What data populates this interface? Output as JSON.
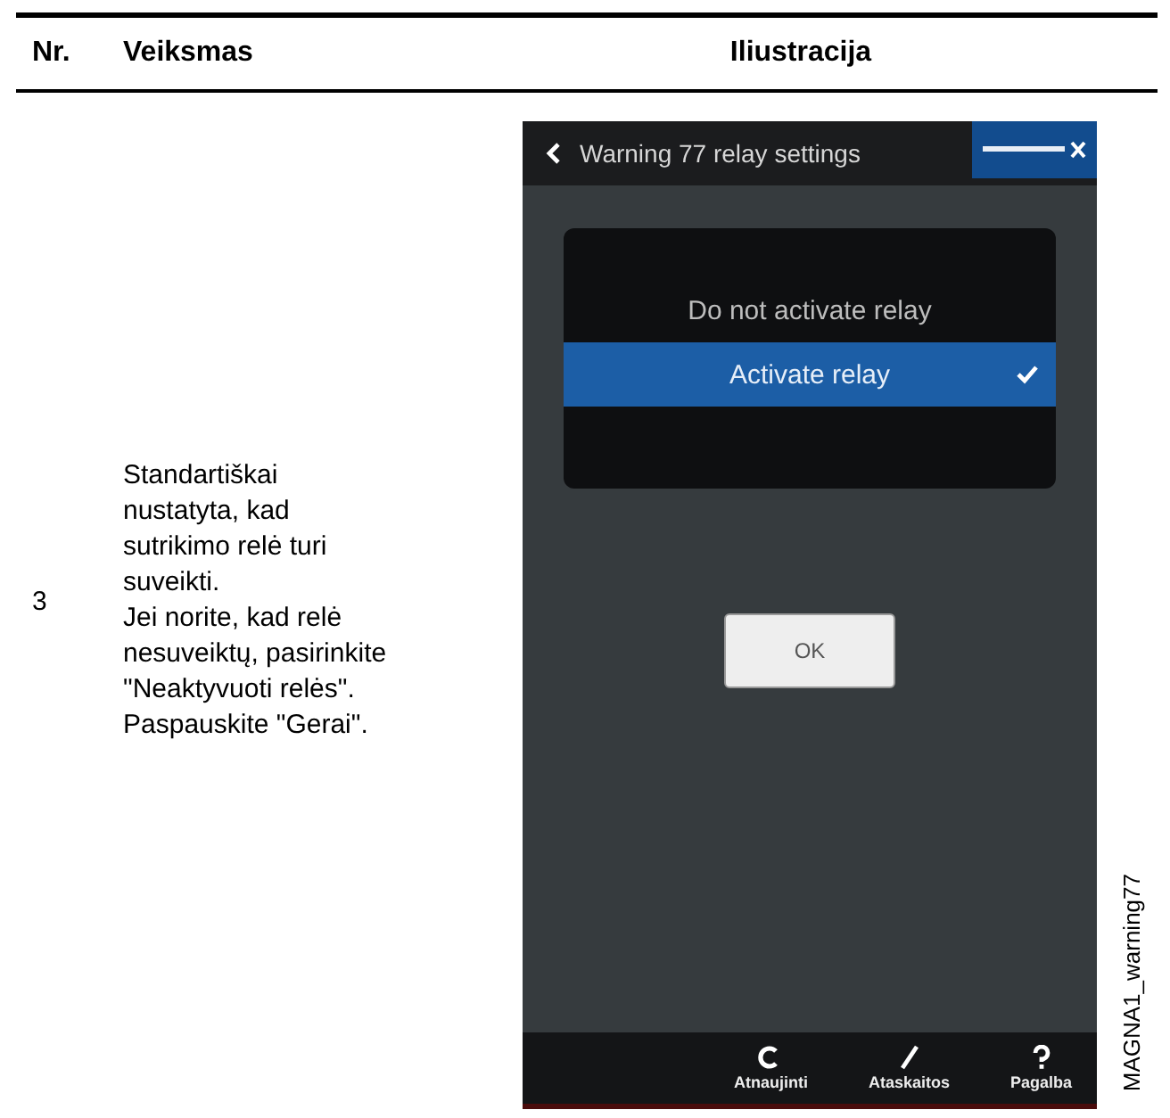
{
  "table": {
    "columns": [
      "Nr.",
      "Veiksmas",
      "Iliustracija"
    ],
    "rows": [
      {
        "number": "3",
        "action": "Standartiškai nustatyta, kad sutrikimo relė turi suveikti.\nJei norite, kad relė nesuveiktų, pasirinkite \"Neaktyvuoti relės\". Paspauskite \"Gerai\".",
        "illustration": {
          "title": "Warning 77 relay settings",
          "options": [
            {
              "label": "Do not activate relay",
              "selected": false
            },
            {
              "label": "Activate relay",
              "selected": true
            }
          ],
          "button": "OK",
          "nav": [
            {
              "kind": "refresh",
              "label": "Atnaujinti"
            },
            {
              "kind": "pen",
              "label": "Ataskaitos"
            },
            {
              "kind": "help",
              "label": "Pagalba"
            }
          ],
          "caption": "MAGNA1_warning77"
        }
      }
    ]
  }
}
